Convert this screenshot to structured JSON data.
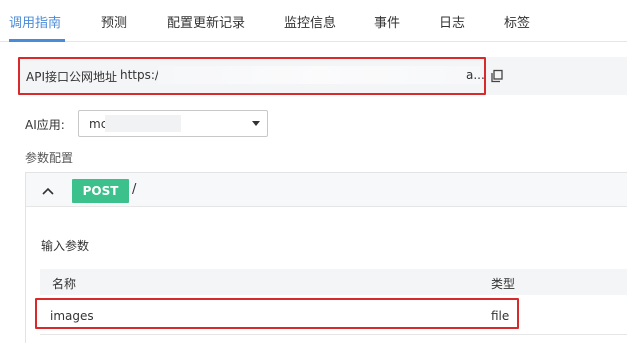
{
  "tabs": [
    {
      "label": "调用指南",
      "active": true
    },
    {
      "label": "预测",
      "active": false
    },
    {
      "label": "配置更新记录",
      "active": false
    },
    {
      "label": "监控信息",
      "active": false
    },
    {
      "label": "事件",
      "active": false
    },
    {
      "label": "日志",
      "active": false
    },
    {
      "label": "标签",
      "active": false
    }
  ],
  "api": {
    "label": "API接口公网地址",
    "url_visible_prefix": "https:/",
    "url_visible_suffix": "a...",
    "copy_icon": "copy-icon"
  },
  "ai_app": {
    "label": "AI应用:",
    "selected_value": "mc"
  },
  "params": {
    "title": "参数配置",
    "method": "POST",
    "path": "/",
    "input_title": "输入参数",
    "columns": [
      "名称",
      "类型"
    ],
    "rows": [
      {
        "name": "images",
        "type": "file"
      }
    ]
  },
  "colors": {
    "accent": "#4a8bd8",
    "post_badge": "#3cc18d",
    "highlight": "#d82a2a"
  }
}
